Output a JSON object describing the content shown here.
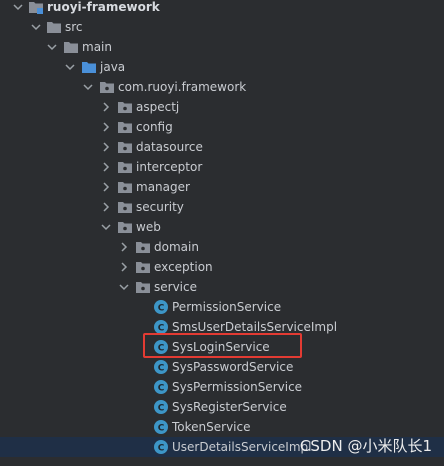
{
  "tree": {
    "root": "ruoyi-framework",
    "src": "src",
    "main": "main",
    "java": "java",
    "package": "com.ruoyi.framework",
    "packages": [
      "aspectj",
      "config",
      "datasource",
      "interceptor",
      "manager",
      "security",
      "web"
    ],
    "web_children": [
      "domain",
      "exception",
      "service"
    ],
    "services": [
      "PermissionService",
      "SmsUserDetailsServiceImpl",
      "SysLoginService",
      "SysPasswordService",
      "SysPermissionService",
      "SysRegisterService",
      "TokenService",
      "UserDetailsServiceImpl"
    ]
  },
  "watermark": "CSDN @小米队长1",
  "colors": {
    "background": "#2b2d30",
    "text": "#c9ccd1",
    "folder": "#8a8f98",
    "java_folder": "#4a90d9",
    "class_icon": "#3d96c7",
    "highlight": "#e33b33"
  }
}
